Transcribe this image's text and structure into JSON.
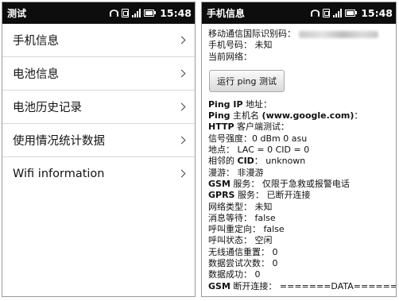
{
  "left": {
    "status_title": "测试",
    "clock": "15:48",
    "menu": [
      {
        "label": "手机信息"
      },
      {
        "label": "电池信息"
      },
      {
        "label": "电池历史记录"
      },
      {
        "label": "使用情况统计数据"
      },
      {
        "label": "Wifi information"
      }
    ]
  },
  "right": {
    "status_title": "手机信息",
    "clock": "15:48",
    "imei_label": "移动通信国际识别码：",
    "phone_number": "手机号码： 未知",
    "current_network": "当前网络：",
    "ping_button": "运行 ping 测试",
    "rows": [
      {
        "bold": "Ping IP",
        "rest": " 地址："
      },
      {
        "bold": "Ping",
        "rest": " 主机名 ",
        "bold2": "(www.google.com)",
        "rest2": "："
      },
      {
        "bold": "HTTP",
        "rest": " 客户端测试："
      },
      {
        "bold": "",
        "rest": "信号强度：0 dBm   0 asu"
      },
      {
        "bold": "",
        "rest": "地点： LAC = 0   CID = 0"
      },
      {
        "bold": "",
        "rest": "相邻的 ",
        "bold2": "CID",
        "rest2": "： unknown"
      },
      {
        "bold": "",
        "rest": "漫游： 非漫游"
      },
      {
        "bold": "GSM",
        "rest": " 服务： 仅限于急救或报警电话"
      },
      {
        "bold": "GPRS",
        "rest": " 服务： 已断开连接"
      },
      {
        "bold": "",
        "rest": "网络类型： 未知"
      },
      {
        "bold": "",
        "rest": "消息等待： false"
      },
      {
        "bold": "",
        "rest": "呼叫重定向： false"
      },
      {
        "bold": "",
        "rest": "呼叫状态： 空闲"
      },
      {
        "bold": "",
        "rest": "无线通信重置： 0"
      },
      {
        "bold": "",
        "rest": "数据尝试次数： 0"
      },
      {
        "bold": "",
        "rest": "数据成功： 0"
      },
      {
        "bold": "GSM",
        "rest": " 断开连接： =======DATA======="
      }
    ]
  },
  "colors": {
    "statusbar": "#0d0d0d",
    "divider": "#d8d8d8",
    "text": "#111111"
  },
  "icons": [
    "wifi-icon",
    "sim-icon",
    "signal-icon",
    "battery-icon",
    "chevron-right-icon"
  ]
}
